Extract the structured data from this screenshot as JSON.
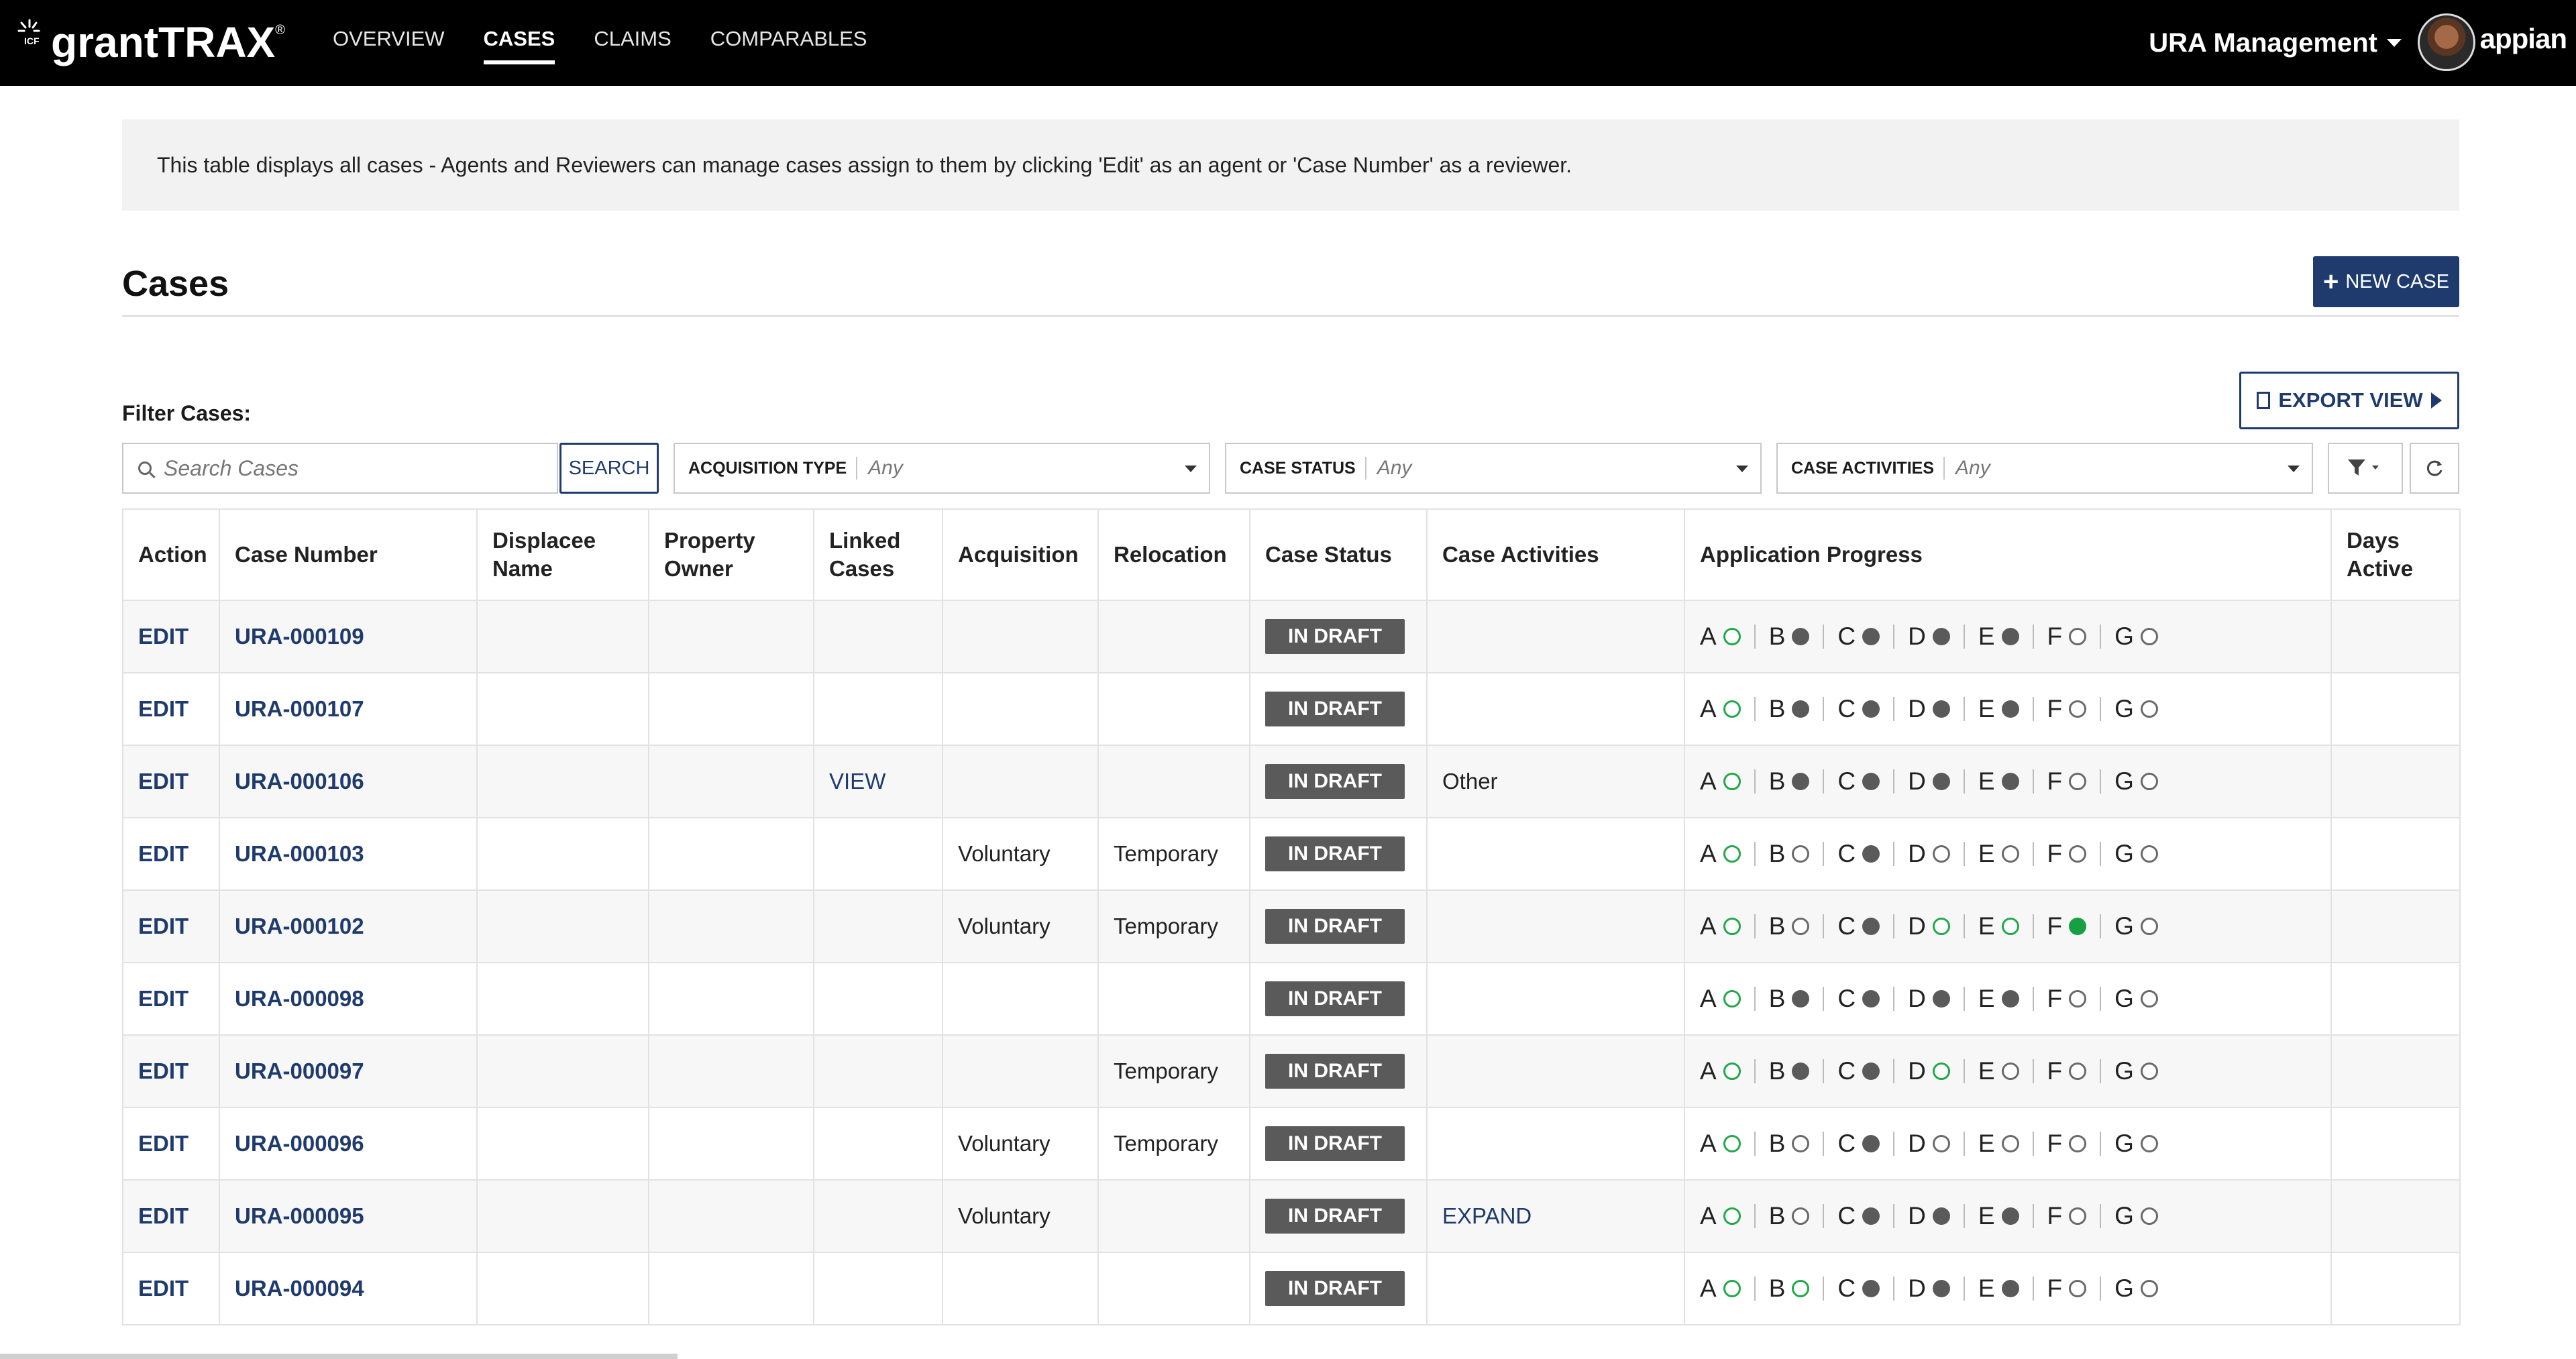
{
  "header": {
    "logo_mark": "ICF",
    "logo_text": "grantTRAX",
    "logo_tm": "®",
    "tabs": [
      {
        "label": "OVERVIEW",
        "active": false
      },
      {
        "label": "CASES",
        "active": true
      },
      {
        "label": "CLAIMS",
        "active": false
      },
      {
        "label": "COMPARABLES",
        "active": false
      }
    ],
    "user_menu_label": "URA Management",
    "vendor_logo": "appian"
  },
  "banner": {
    "text": "This table displays all cases - Agents and Reviewers can manage cases assign to them by clicking 'Edit' as an agent or 'Case Number' as a reviewer."
  },
  "page": {
    "title": "Cases",
    "new_case_label": "NEW CASE",
    "export_label": "EXPORT VIEW"
  },
  "filters": {
    "label": "Filter Cases:",
    "search_placeholder": "Search Cases",
    "search_button": "SEARCH",
    "acquisition_type": {
      "label": "ACQUISITION TYPE",
      "value": "Any"
    },
    "case_status": {
      "label": "CASE STATUS",
      "value": "Any"
    },
    "case_activities": {
      "label": "CASE ACTIVITIES",
      "value": "Any"
    }
  },
  "table": {
    "columns": [
      "Action",
      "Case Number",
      "Displacee Name",
      "Property Owner",
      "Linked Cases",
      "Acquisition",
      "Relocation",
      "Case Status",
      "Case Activities",
      "Application Progress",
      "Days Active"
    ],
    "step_letters": [
      "A",
      "B",
      "C",
      "D",
      "E",
      "F",
      "G"
    ],
    "rows": [
      {
        "action": "EDIT",
        "case_number": "URA-000109",
        "displacee": "",
        "owner": "",
        "linked": "",
        "acquisition": "",
        "relocation": "",
        "status": "IN DRAFT",
        "activities": "",
        "progress": [
          "open",
          "filled",
          "filled",
          "filled",
          "filled",
          "empty",
          "empty"
        ],
        "days": ""
      },
      {
        "action": "EDIT",
        "case_number": "URA-000107",
        "displacee": "",
        "owner": "",
        "linked": "",
        "acquisition": "",
        "relocation": "",
        "status": "IN DRAFT",
        "activities": "",
        "progress": [
          "open",
          "filled",
          "filled",
          "filled",
          "filled",
          "empty",
          "empty"
        ],
        "days": ""
      },
      {
        "action": "EDIT",
        "case_number": "URA-000106",
        "displacee": "",
        "owner": "",
        "linked": "VIEW",
        "acquisition": "",
        "relocation": "",
        "status": "IN DRAFT",
        "activities": "Other",
        "progress": [
          "open",
          "filled",
          "filled",
          "filled",
          "filled",
          "empty",
          "empty"
        ],
        "days": ""
      },
      {
        "action": "EDIT",
        "case_number": "URA-000103",
        "displacee": "",
        "owner": "",
        "linked": "",
        "acquisition": "Voluntary",
        "relocation": "Temporary",
        "status": "IN DRAFT",
        "activities": "",
        "progress": [
          "open",
          "empty",
          "filled",
          "empty",
          "empty",
          "empty",
          "empty"
        ],
        "days": ""
      },
      {
        "action": "EDIT",
        "case_number": "URA-000102",
        "displacee": "",
        "owner": "",
        "linked": "",
        "acquisition": "Voluntary",
        "relocation": "Temporary",
        "status": "IN DRAFT",
        "activities": "",
        "progress": [
          "open",
          "empty",
          "filled",
          "open",
          "open",
          "done",
          "empty"
        ],
        "days": ""
      },
      {
        "action": "EDIT",
        "case_number": "URA-000098",
        "displacee": "",
        "owner": "",
        "linked": "",
        "acquisition": "",
        "relocation": "",
        "status": "IN DRAFT",
        "activities": "",
        "progress": [
          "open",
          "filled",
          "filled",
          "filled",
          "filled",
          "empty",
          "empty"
        ],
        "days": ""
      },
      {
        "action": "EDIT",
        "case_number": "URA-000097",
        "displacee": "",
        "owner": "",
        "linked": "",
        "acquisition": "",
        "relocation": "Temporary",
        "status": "IN DRAFT",
        "activities": "",
        "progress": [
          "open",
          "filled",
          "filled",
          "open",
          "empty",
          "empty",
          "empty"
        ],
        "days": ""
      },
      {
        "action": "EDIT",
        "case_number": "URA-000096",
        "displacee": "",
        "owner": "",
        "linked": "",
        "acquisition": "Voluntary",
        "relocation": "Temporary",
        "status": "IN DRAFT",
        "activities": "",
        "progress": [
          "open",
          "empty",
          "filled",
          "empty",
          "empty",
          "empty",
          "empty"
        ],
        "days": ""
      },
      {
        "action": "EDIT",
        "case_number": "URA-000095",
        "displacee": "",
        "owner": "",
        "linked": "",
        "acquisition": "Voluntary",
        "relocation": "",
        "status": "IN DRAFT",
        "activities": "EXPAND",
        "progress": [
          "open",
          "empty",
          "filled",
          "filled",
          "filled",
          "empty",
          "empty"
        ],
        "days": ""
      },
      {
        "action": "EDIT",
        "case_number": "URA-000094",
        "displacee": "",
        "owner": "",
        "linked": "",
        "acquisition": "",
        "relocation": "",
        "status": "IN DRAFT",
        "activities": "",
        "progress": [
          "open",
          "open",
          "filled",
          "filled",
          "filled",
          "empty",
          "empty"
        ],
        "days": ""
      }
    ]
  },
  "colors": {
    "primary": "#1f3b6d",
    "status_badge": "#5a5a5a",
    "progress_open": "#22a84a",
    "progress_done": "#16a043"
  }
}
